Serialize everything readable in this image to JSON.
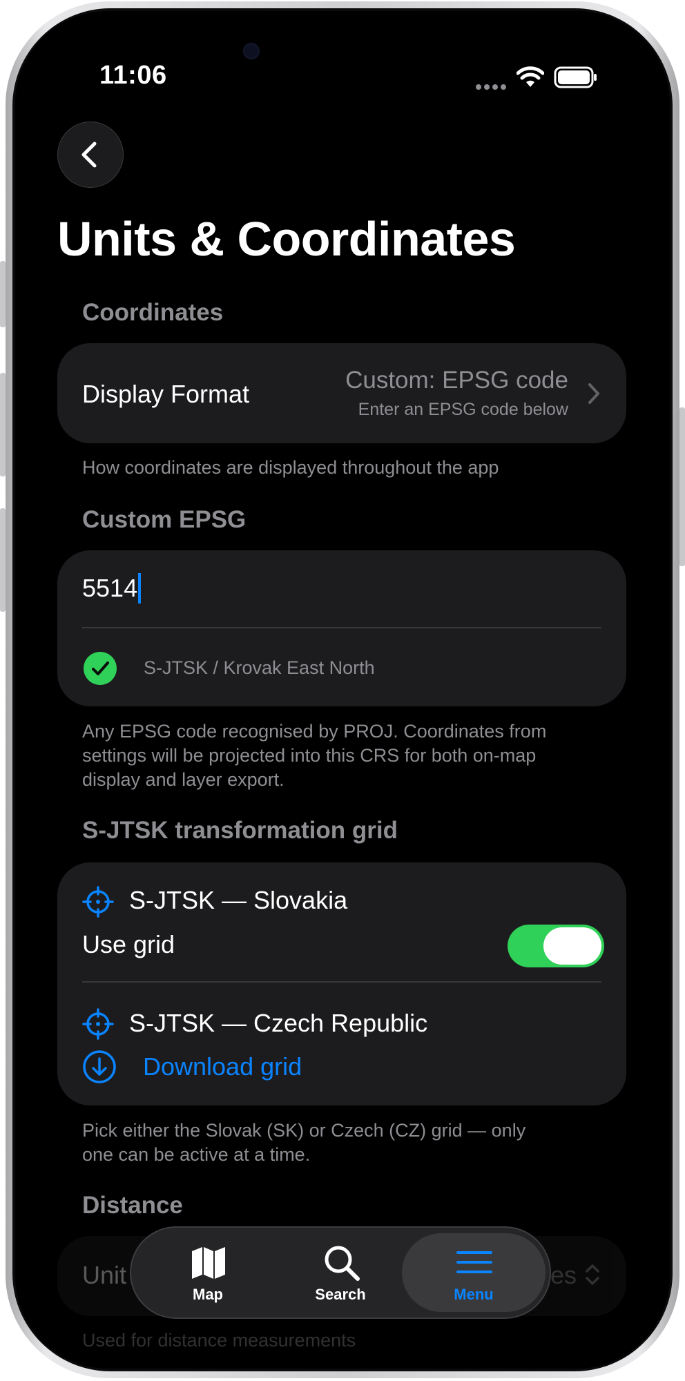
{
  "status_bar": {
    "time": "11:06"
  },
  "page": {
    "title": "Units & Coordinates"
  },
  "coordinates": {
    "header": "Coordinates",
    "display_format_label": "Display Format",
    "display_format_value": "Custom: EPSG code",
    "display_format_subtitle": "Enter an EPSG code below",
    "footer": "How coordinates are displayed throughout the app"
  },
  "custom_epsg": {
    "header": "Custom EPSG",
    "input_value": "5514",
    "validation_text": "S-JTSK / Krovak East North",
    "footer_line1": "Any EPSG code recognised by PROJ. Coordinates from",
    "footer_line2": "settings will be projected into this CRS for both on-map",
    "footer_line3": "display and layer export."
  },
  "sjtsk_grid": {
    "header": "S-JTSK transformation grid",
    "slovakia_name": "S-JTSK — Slovakia",
    "use_grid_label": "Use grid",
    "use_grid_on": true,
    "czech_name": "S-JTSK — Czech Republic",
    "download_label": "Download grid",
    "footer_line1": "Pick either the Slovak (SK) or Czech (CZ) grid — only",
    "footer_line2": "one can be active at a time."
  },
  "distance": {
    "header": "Distance",
    "units_label_partial": "Unit",
    "units_value_partial": "es",
    "footer": "Used for distance measurements"
  },
  "tab_bar": {
    "map_label": "Map",
    "search_label": "Search",
    "menu_label": "Menu",
    "active_tab": "Menu"
  },
  "colors": {
    "accent": "#0a84ff",
    "toggle_on": "#30d158",
    "success": "#30d158",
    "background": "#000000",
    "card": "#1c1c1e",
    "secondary_text": "#8e8e93"
  }
}
